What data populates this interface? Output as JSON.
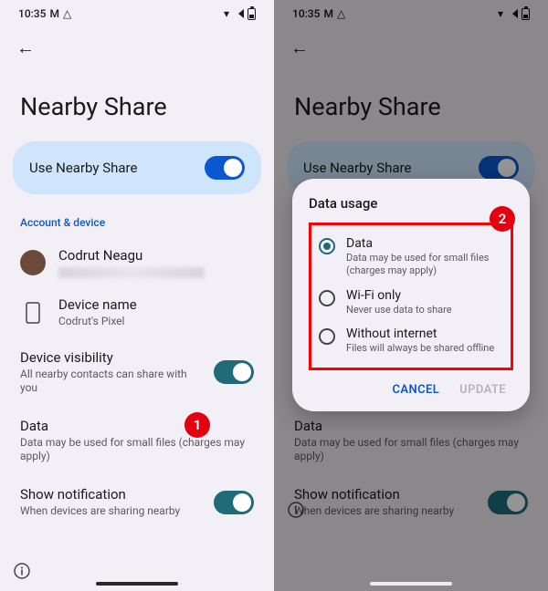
{
  "status": {
    "time": "10:35",
    "icons": [
      "M",
      "△"
    ]
  },
  "page_title": "Nearby Share",
  "back_icon": "←",
  "use_toggle": {
    "label": "Use Nearby Share",
    "on": true
  },
  "section_label": "Account & device",
  "account": {
    "name": "Codrut Neagu"
  },
  "device": {
    "label": "Device name",
    "value": "Codrut's Pixel"
  },
  "visibility": {
    "title": "Device visibility",
    "sub": "All nearby contacts can share with you",
    "on": true
  },
  "data_row": {
    "title": "Data",
    "sub": "Data may be used for small files (charges may apply)"
  },
  "notif": {
    "title": "Show notification",
    "sub": "When devices are sharing nearby",
    "on": true
  },
  "callouts": {
    "one": "1",
    "two": "2"
  },
  "dialog": {
    "title": "Data usage",
    "options": [
      {
        "title": "Data",
        "sub": "Data may be used for small files (charges may apply)",
        "checked": true
      },
      {
        "title": "Wi-Fi only",
        "sub": "Never use data to share",
        "checked": false
      },
      {
        "title": "Without internet",
        "sub": "Files will always be shared offline",
        "checked": false
      }
    ],
    "cancel": "CANCEL",
    "update": "UPDATE"
  }
}
